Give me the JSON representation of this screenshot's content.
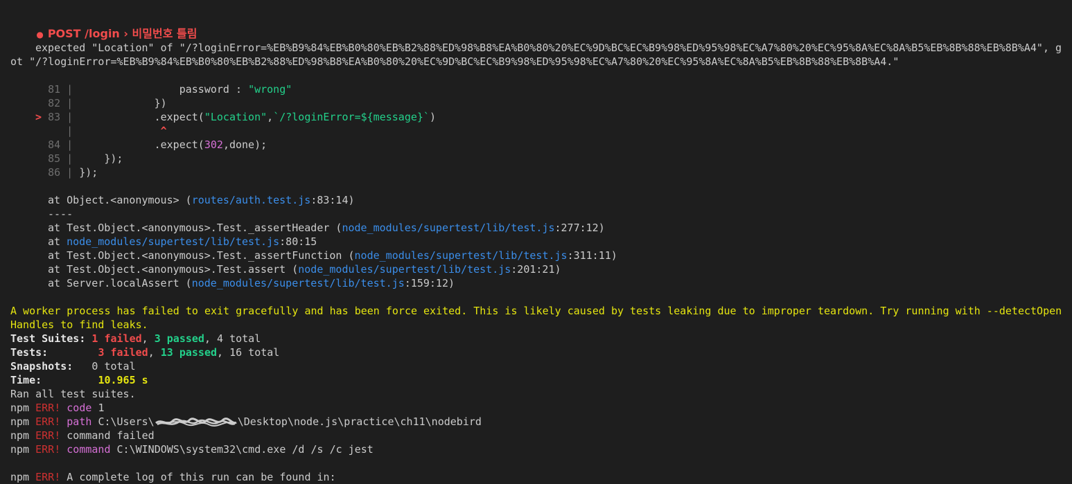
{
  "test_title": {
    "bullet": "●",
    "text": "POST /login › 비밀번호 틀림"
  },
  "assertion": {
    "line1": "expected \"Location\" of \"/?loginError=%EB%B9%84%EB%B0%80%EB%B2%88%ED%98%B8%EA%B0%80%20%EC%9D%BC%EC%B9%98%ED%95%98%EC%A7%80%20%EC%95%8A%EC%8A%B5%EB%8B%88%EB%8B%A4\", g",
    "line2": "ot \"/?loginError=%EB%B9%84%EB%B0%80%EB%B2%88%ED%98%B8%EA%B0%80%20%EC%9D%BC%EC%B9%98%ED%95%98%EC%A7%80%20%EC%95%8A%EC%8A%B5%EB%8B%88%EB%8B%A4.\""
  },
  "code_frame": {
    "marker": ">",
    "caret": "^",
    "lines": [
      {
        "num": "81",
        "code": "                password : ",
        "str": "\"wrong\""
      },
      {
        "num": "82",
        "code": "            })"
      },
      {
        "num": "83",
        "code": "            .expect(",
        "str": "\"Location\"",
        "code2": ",",
        "str2": "`/?loginError=${message}`",
        "code3": ")"
      },
      {
        "num": "84",
        "code": "            .expect(",
        "numval": "302",
        "code2": ",done);"
      },
      {
        "num": "85",
        "code": "    });"
      },
      {
        "num": "86",
        "code": "});"
      }
    ]
  },
  "stack": {
    "first": {
      "prefix": "at Object.<anonymous> (",
      "file": "routes/auth.test.js",
      "suffix": ":83:14)"
    },
    "separator": "----",
    "frames": [
      {
        "prefix": "at Test.Object.<anonymous>.Test._assertHeader (",
        "file": "node_modules/supertest/lib/test.js",
        "suffix": ":277:12)"
      },
      {
        "prefix": "at ",
        "file": "node_modules/supertest/lib/test.js",
        "suffix": ":80:15"
      },
      {
        "prefix": "at Test.Object.<anonymous>.Test._assertFunction (",
        "file": "node_modules/supertest/lib/test.js",
        "suffix": ":311:11)"
      },
      {
        "prefix": "at Test.Object.<anonymous>.Test.assert (",
        "file": "node_modules/supertest/lib/test.js",
        "suffix": ":201:21)"
      },
      {
        "prefix": "at Server.localAssert (",
        "file": "node_modules/supertest/lib/test.js",
        "suffix": ":159:12)"
      }
    ]
  },
  "warning": {
    "line1": "A worker process has failed to exit gracefully and has been force exited. This is likely caused by tests leaking due to improper teardown. Try running with --detectOpen",
    "line2": "Handles to find leaks."
  },
  "summary": {
    "suites_label": "Test Suites:",
    "suites_failed": "1 failed",
    "suites_passed": "3 passed",
    "suites_total": ", 4 total",
    "tests_label": "Tests:",
    "tests_failed": "3 failed",
    "tests_passed": "13 passed",
    "tests_total": ", 16 total",
    "snapshots_label": "Snapshots:",
    "snapshots_value": "0 total",
    "time_label": "Time:",
    "time_value": "10.965 s",
    "ran": "Ran all test suites."
  },
  "npm_errors": {
    "npm": "npm",
    "err": "ERR!",
    "lines": [
      {
        "key": "code",
        "value": "1"
      },
      {
        "key": "path",
        "value_pre": "C:\\Users\\",
        "value_post": "\\Desktop\\node.js\\practice\\ch11\\nodebird"
      },
      {
        "plain": "command failed"
      },
      {
        "key": "command",
        "value": "C:\\WINDOWS\\system32\\cmd.exe /d /s /c jest"
      },
      {
        "plain": "A complete log of this run can be found in:"
      }
    ]
  },
  "colors": {
    "background": "#1e1e1e",
    "error_red": "#f14c4c",
    "pass_green": "#23d18b",
    "warning_yellow": "#e5e510",
    "link_blue": "#3b8eea",
    "magenta": "#d670d6"
  }
}
